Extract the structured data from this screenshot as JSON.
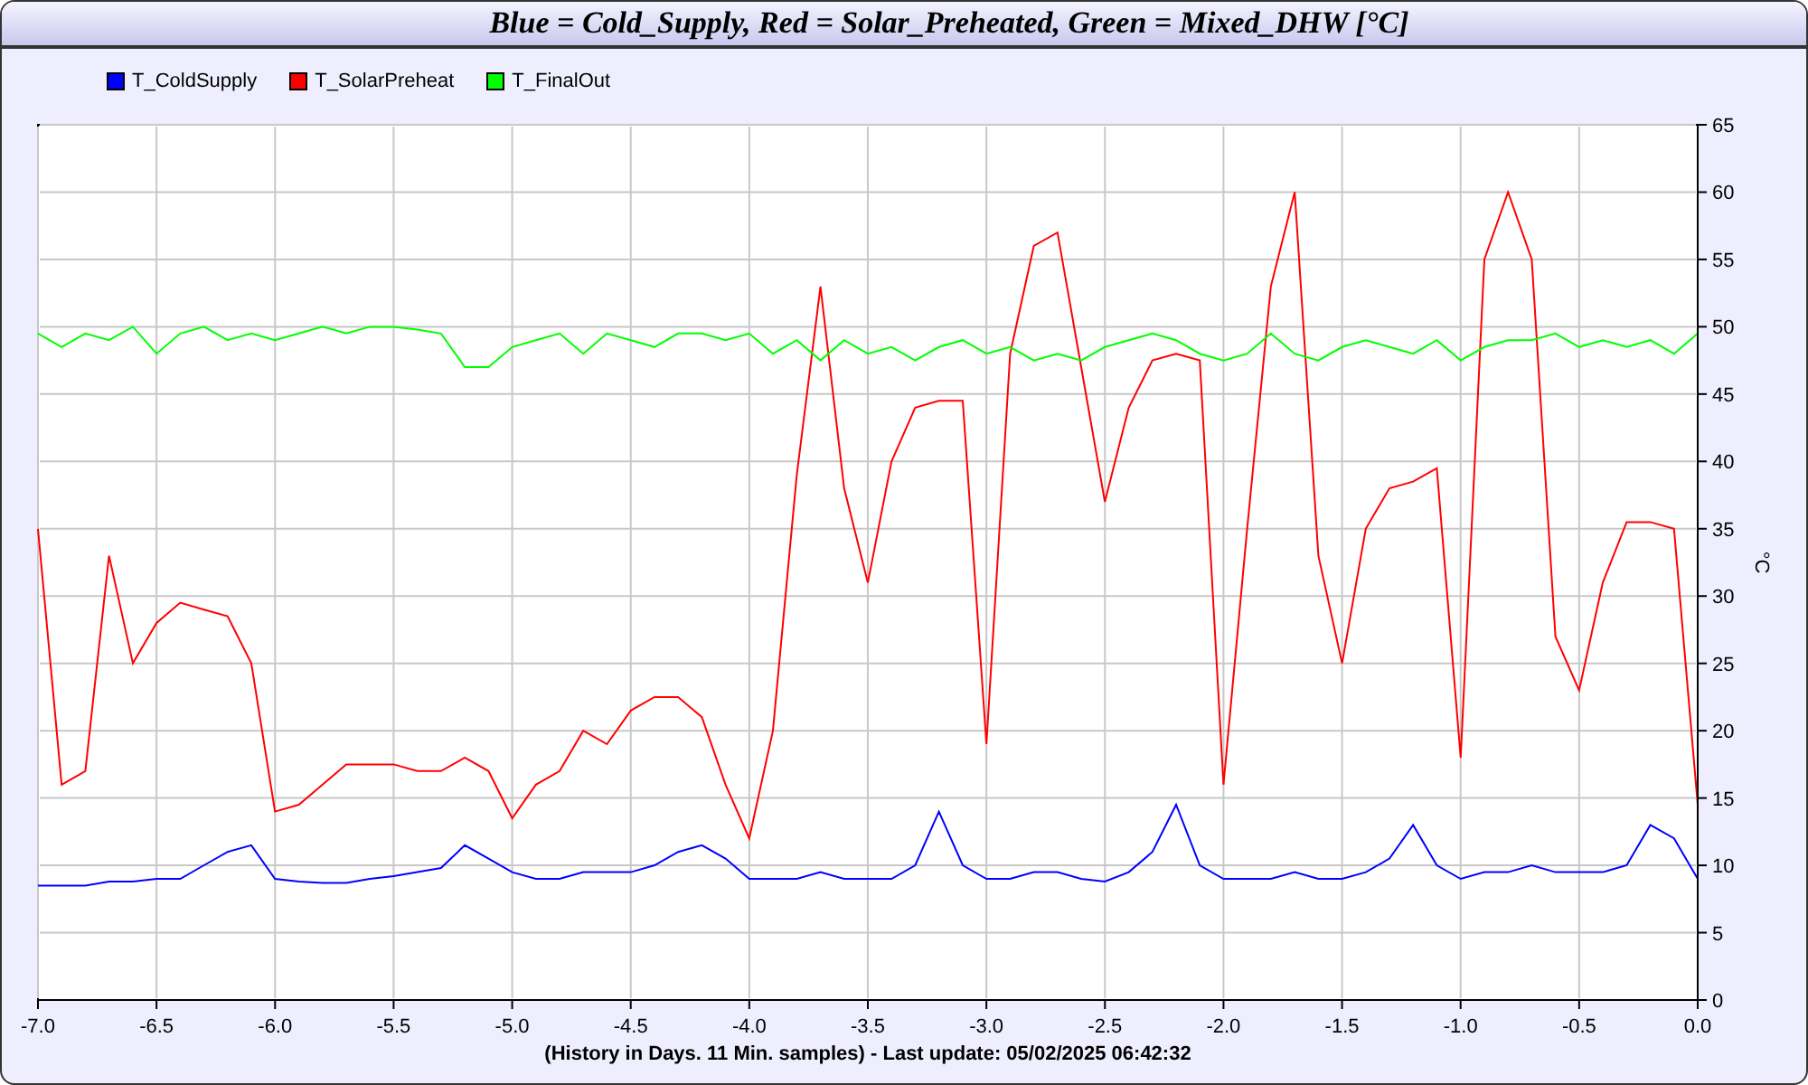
{
  "chart_data": {
    "type": "line",
    "title": "Blue = Cold_Supply, Red = Solar_Preheated, Green = Mixed_DHW [°C]",
    "xlabel": "(History in Days. 11 Min. samples) - Last update: 05/02/2025 06:42:32",
    "ylabel": "°C",
    "x": [
      -7.0,
      -6.9,
      -6.8,
      -6.7,
      -6.6,
      -6.5,
      -6.4,
      -6.3,
      -6.2,
      -6.1,
      -6.0,
      -5.9,
      -5.8,
      -5.7,
      -5.6,
      -5.5,
      -5.4,
      -5.3,
      -5.2,
      -5.1,
      -5.0,
      -4.9,
      -4.8,
      -4.7,
      -4.6,
      -4.5,
      -4.4,
      -4.3,
      -4.2,
      -4.1,
      -4.0,
      -3.9,
      -3.8,
      -3.7,
      -3.6,
      -3.5,
      -3.4,
      -3.3,
      -3.2,
      -3.1,
      -3.0,
      -2.9,
      -2.8,
      -2.7,
      -2.6,
      -2.5,
      -2.4,
      -2.3,
      -2.2,
      -2.1,
      -2.0,
      -1.9,
      -1.8,
      -1.7,
      -1.6,
      -1.5,
      -1.4,
      -1.3,
      -1.2,
      -1.1,
      -1.0,
      -0.9,
      -0.8,
      -0.7,
      -0.6,
      -0.5,
      -0.4,
      -0.3,
      -0.2,
      -0.1,
      0.0
    ],
    "series": [
      {
        "name": "T_ColdSupply",
        "color": "#0000ff",
        "values": [
          8.5,
          8.5,
          8.5,
          8.8,
          8.8,
          9,
          9,
          10,
          11,
          11.5,
          9,
          8.8,
          8.7,
          8.7,
          9,
          9.2,
          9.5,
          9.8,
          11.5,
          10.5,
          9.5,
          9,
          9,
          9.5,
          9.5,
          9.5,
          10,
          11,
          11.5,
          10.5,
          9,
          9,
          9,
          9.5,
          9,
          9,
          9,
          10,
          14,
          10,
          9,
          9,
          9.5,
          9.5,
          9,
          8.8,
          9.5,
          11,
          14.5,
          10,
          9,
          9,
          9,
          9.5,
          9,
          9,
          9.5,
          10.5,
          13,
          10,
          9,
          9.5,
          9.5,
          10,
          9.5,
          9.5,
          9.5,
          10,
          13,
          12,
          9
        ]
      },
      {
        "name": "T_SolarPreheat",
        "color": "#ff0000",
        "values": [
          35,
          16,
          17,
          33,
          25,
          28,
          29.5,
          29,
          28.5,
          25,
          14,
          14.5,
          16,
          17.5,
          17.5,
          17.5,
          17,
          17,
          18,
          17,
          13.5,
          16,
          17,
          20,
          19,
          21.5,
          22.5,
          22.5,
          21,
          16,
          12,
          20,
          39,
          53,
          38,
          31,
          40,
          44,
          44.5,
          44.5,
          19,
          48,
          56,
          57,
          47,
          37,
          44,
          47.5,
          48,
          47.5,
          16,
          35,
          53,
          60,
          33,
          25,
          35,
          38,
          38.5,
          39.5,
          18,
          55,
          60,
          55,
          27,
          23,
          31,
          35.5,
          35.5,
          35,
          14.5
        ]
      },
      {
        "name": "T_FinalOut",
        "color": "#00ff00",
        "values": [
          49.5,
          48.5,
          49.5,
          49,
          50,
          48,
          49.5,
          50,
          49,
          49.5,
          49,
          49.5,
          50,
          49.5,
          50,
          50,
          49.8,
          49.5,
          47,
          47,
          48.5,
          49,
          49.5,
          48,
          49.5,
          49,
          48.5,
          49.5,
          49.5,
          49,
          49.5,
          48,
          49,
          47.5,
          49,
          48,
          48.5,
          47.5,
          48.5,
          49,
          48,
          48.5,
          47.5,
          48,
          47.5,
          48.5,
          49,
          49.5,
          49,
          48,
          47.5,
          48,
          49.5,
          48,
          47.5,
          48.5,
          49,
          48.5,
          48,
          49,
          47.5,
          48.5,
          49,
          49,
          49.5,
          48.5,
          49,
          48.5,
          49,
          48,
          49.5
        ]
      }
    ],
    "xlim": [
      -7,
      0
    ],
    "ylim": [
      0,
      65
    ],
    "grid": true,
    "xticks": [
      {
        "value": -7,
        "label": "-7.0"
      },
      {
        "value": -6.5,
        "label": "-6.5"
      },
      {
        "value": -6,
        "label": "-6.0"
      },
      {
        "value": -5.5,
        "label": "-5.5"
      },
      {
        "value": -5,
        "label": "-5.0"
      },
      {
        "value": -4.5,
        "label": "-4.5"
      },
      {
        "value": -4,
        "label": "-4.0"
      },
      {
        "value": -3.5,
        "label": "-3.5"
      },
      {
        "value": -3,
        "label": "-3.0"
      },
      {
        "value": -2.5,
        "label": "-2.5"
      },
      {
        "value": -2,
        "label": "-2.0"
      },
      {
        "value": -1.5,
        "label": "-1.5"
      },
      {
        "value": -1,
        "label": "-1.0"
      },
      {
        "value": -0.5,
        "label": "-0.5"
      },
      {
        "value": 0,
        "label": "0.0"
      }
    ],
    "yticks": [
      0,
      5,
      10,
      15,
      20,
      25,
      30,
      35,
      40,
      45,
      50,
      55,
      60,
      65
    ]
  }
}
